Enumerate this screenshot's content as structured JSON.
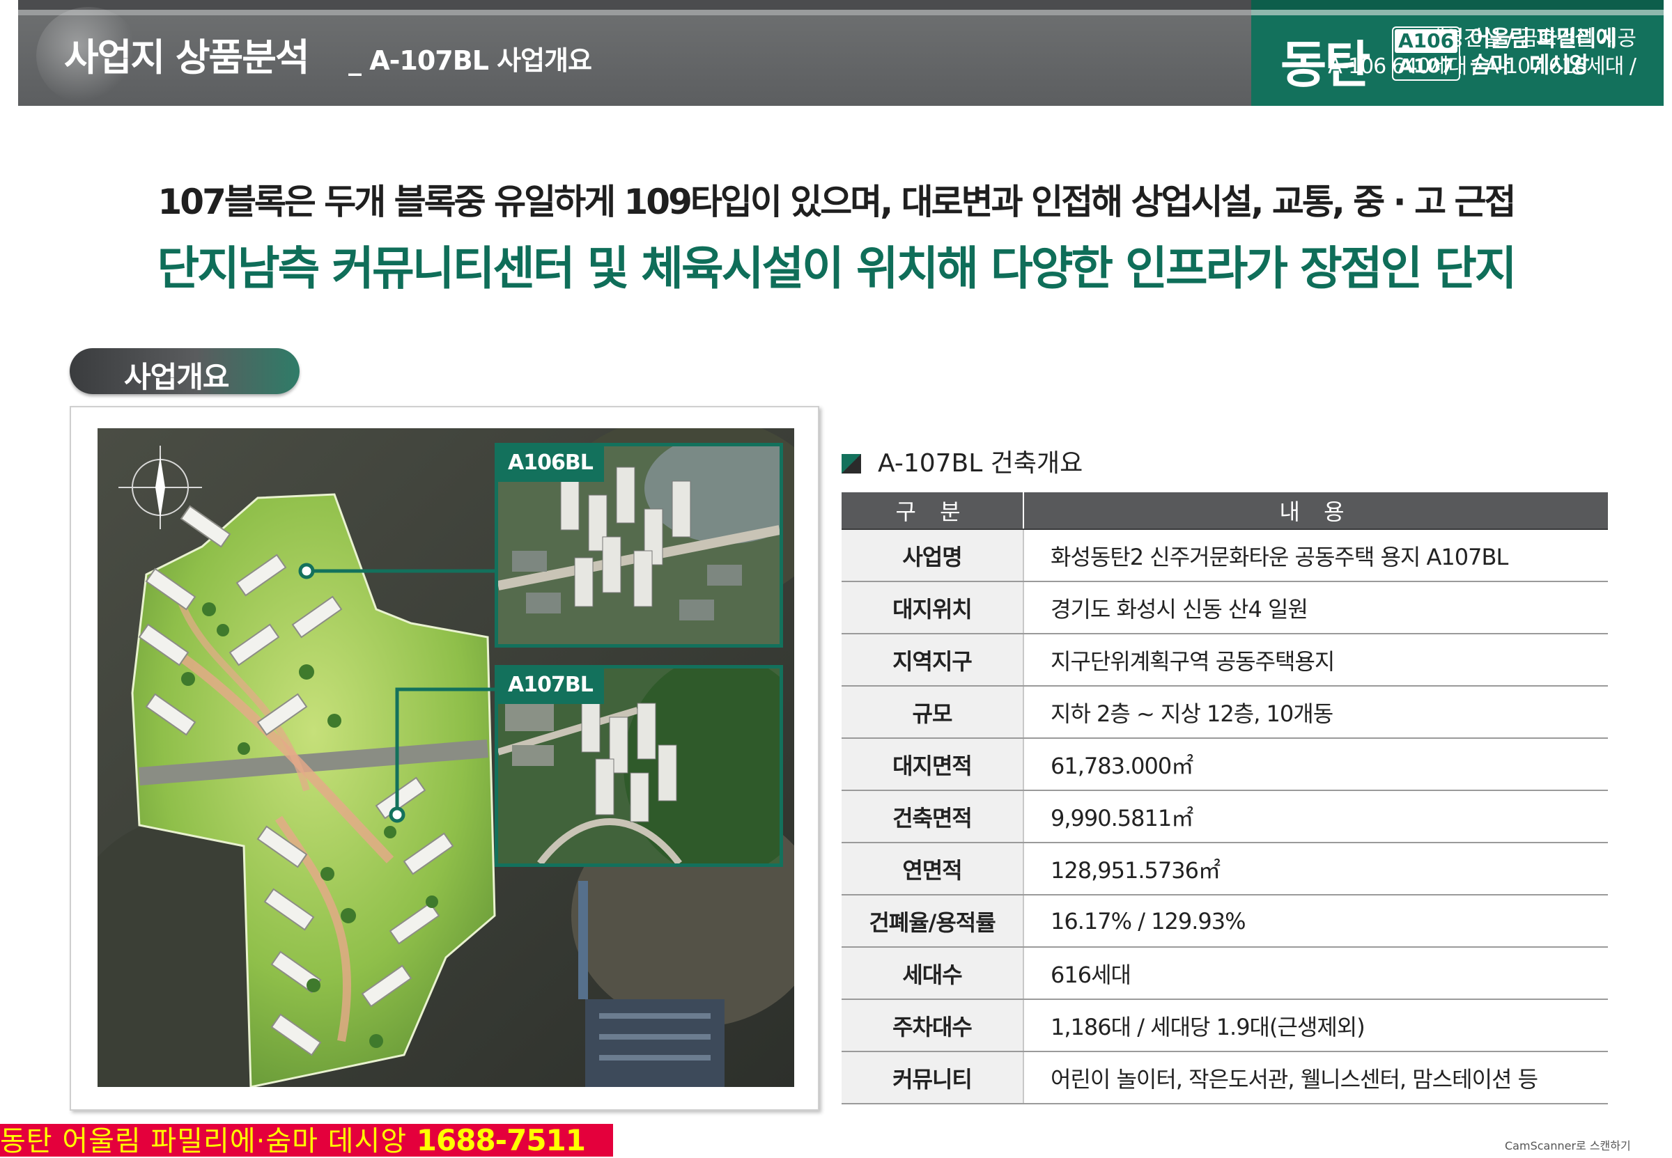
{
  "header": {
    "title": "사업지 상품분석",
    "subtitle": "_ A-107BL 사업개요",
    "builders_line1": "태영건설 / 금호건설 시공",
    "builders_line2": "A-106 640세대 / A-107 616세대 /",
    "brand_main": "동탄",
    "brand_code_top": "A106",
    "brand_code_bottom": "A107",
    "brand_name_line1": "어울림 파밀리에",
    "brand_name_line2": "숨마 데시앙"
  },
  "headline": {
    "line1": "107블록은 두개 블록중 유일하게 109타입이 있으며, 대로변과 인접해 상업시설, 교통, 중 · 고 근접",
    "line2": "단지남측 커뮤니티센터 및 체육시설이 위치해 다양한 인프라가 장점인 단지"
  },
  "section": {
    "label": "사업개요"
  },
  "site_plan": {
    "inset1_label": "A106BL",
    "inset2_label": "A107BL"
  },
  "spec": {
    "heading": "A-107BL 건축개요",
    "col1": "구 분",
    "col2": "내 용",
    "rows": [
      {
        "label": "사업명",
        "value": "화성동탄2 신주거문화타운 공동주택 용지  A107BL"
      },
      {
        "label": "대지위치",
        "value": "경기도 화성시 신동 산4 일원"
      },
      {
        "label": "지역지구",
        "value": "지구단위계획구역 공동주택용지"
      },
      {
        "label": "규모",
        "value": "지하 2층 ~ 지상 12층, 10개동"
      },
      {
        "label": "대지면적",
        "value": "61,783.000㎡"
      },
      {
        "label": "건축면적",
        "value": "9,990.5811㎡"
      },
      {
        "label": "연면적",
        "value": "128,951.5736㎡"
      },
      {
        "label": "건폐율/용적률",
        "value": "16.17% / 129.93%"
      },
      {
        "label": "세대수",
        "value": "616세대"
      },
      {
        "label": "주차대수",
        "value": "1,186대 / 세대당 1.9대(근생제외)"
      },
      {
        "label": "커뮤니티",
        "value": "어린이 놀이터, 작은도서관, 웰니스센터, 맘스테이션 등"
      }
    ]
  },
  "footer": {
    "banner_text": "동탄 어울림 파밀리에·숨마 데시앙",
    "phone": "1688-7511",
    "scanner": "CamScanner로 스캔하기"
  },
  "colors": {
    "brand_green": "#13715c",
    "header_gray": "#5c5e60",
    "banner_red": "#e4003c",
    "banner_text": "#ffff00"
  }
}
